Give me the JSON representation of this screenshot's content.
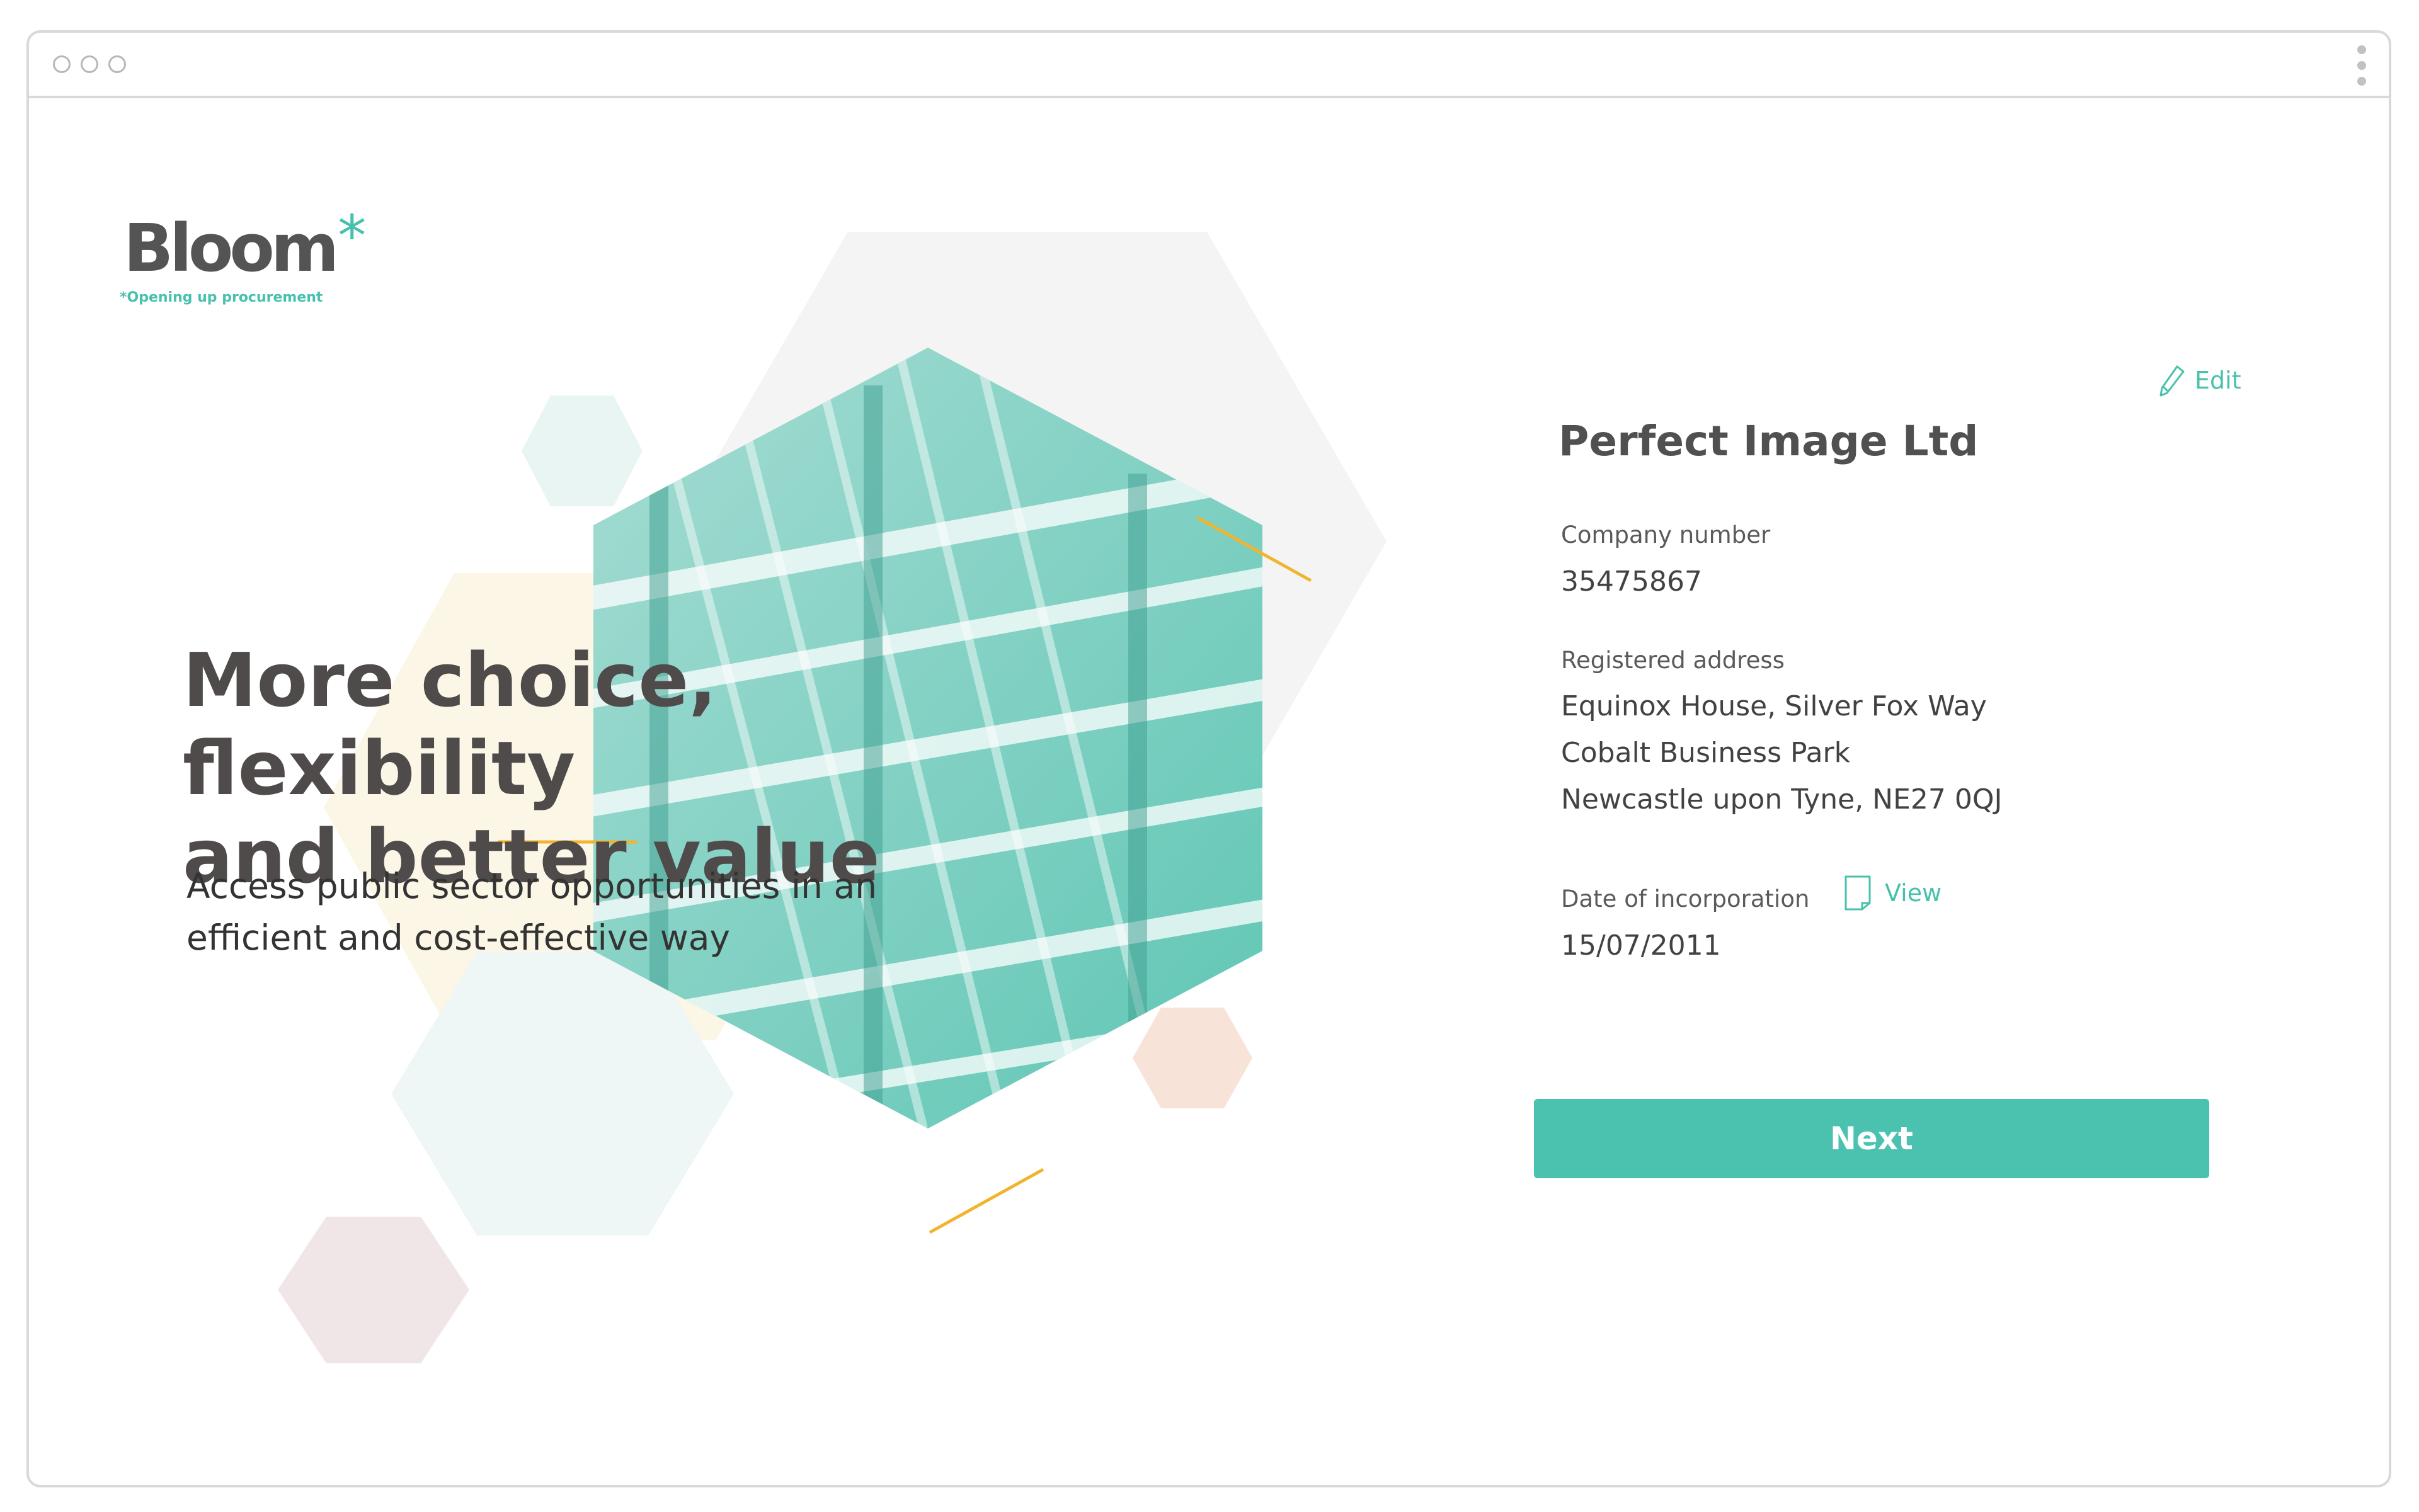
{
  "brand": {
    "name": "Bloom",
    "star": "*",
    "tagline": "*Opening up procurement",
    "accent": "#47c1ad",
    "highlight": "#f2b42e"
  },
  "hero": {
    "headline_line1": "More choice, flexibility",
    "headline_line2": "and better value",
    "subhead_line1": "Access public sector opportunities in an",
    "subhead_line2": "efficient and cost-effective way"
  },
  "company": {
    "edit_label": "Edit",
    "name": "Perfect Image Ltd",
    "number_label": "Company number",
    "number": "35475867",
    "address_label": "Registered address",
    "address_line1": "Equinox House, Silver Fox Way",
    "address_line2": "Cobalt Business Park",
    "address_line3": "Newcastle upon Tyne, NE27 0QJ",
    "incorporation_label": "Date of incorporation",
    "view_label": "View",
    "incorporation_date": "15/07/2011"
  },
  "actions": {
    "next_label": "Next"
  },
  "icons": {
    "edit": "pencil-icon",
    "view": "document-icon",
    "menu": "kebab-menu-icon"
  }
}
